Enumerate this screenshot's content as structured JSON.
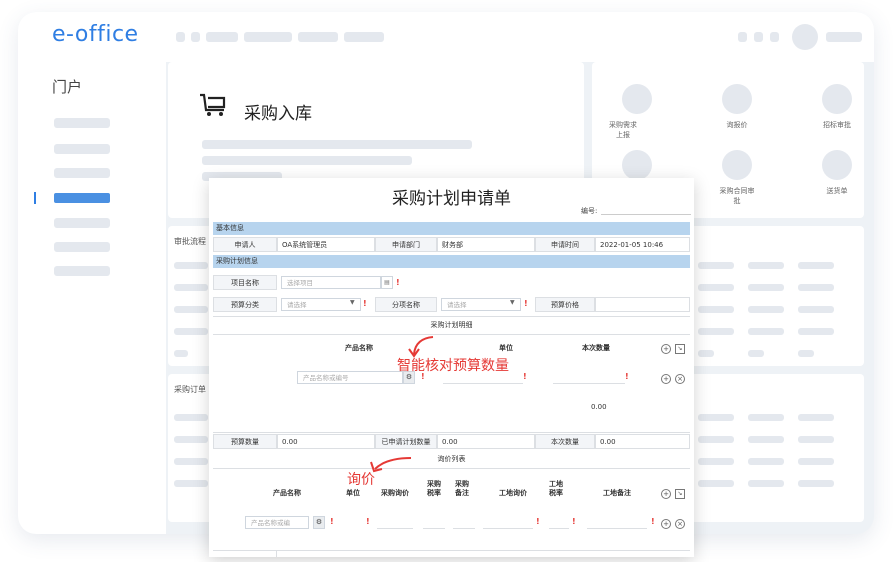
{
  "app": {
    "logo": "e-office"
  },
  "sidebar": {
    "title": "门户"
  },
  "module": {
    "title": "采购入库"
  },
  "quick_links": [
    {
      "label": "采购需求上报"
    },
    {
      "label": "询报价"
    },
    {
      "label": "招标审批"
    },
    {
      "label": "采购合同审批"
    },
    {
      "label": "送货单"
    }
  ],
  "sections": {
    "approval": "审批流程",
    "orders": "采购订单"
  },
  "form": {
    "title": "采购计划申请单",
    "number_label": "编号:",
    "basic_info": "基本信息",
    "applicant_label": "申请人",
    "applicant_value": "OA系统管理员",
    "dept_label": "申请部门",
    "dept_value": "财务部",
    "time_label": "申请时间",
    "time_value": "2022-01-05 10:46",
    "plan_info": "采购计划信息",
    "project_label": "项目名称",
    "project_placeholder": "选择项目",
    "budget_cat_label": "预算分类",
    "budget_cat_placeholder": "请选择",
    "sub_label": "分项名称",
    "sub_placeholder": "请选择",
    "budget_price_label": "预算价格",
    "plan_detail": "采购计划明细",
    "col_product": "产品名称",
    "col_unit": "单位",
    "col_qty": "本次数量",
    "product_placeholder": "产品名称或编号",
    "total": "0.00",
    "budget_qty_label": "预算数量",
    "budget_qty_value": "0.00",
    "planned_qty_label": "已申请计划数量",
    "planned_qty_value": "0.00",
    "this_qty_label": "本次数量",
    "this_qty_value": "0.00",
    "inquiry_list": "询价列表",
    "inq_col_product": "产品名称",
    "inq_col_unit": "单位",
    "inq_col_price": "采购询价",
    "inq_col_tax": "采购税率",
    "inq_col_note": "采购备注",
    "inq_col_site_price": "工地询价",
    "inq_col_site_tax": "工地税率",
    "inq_col_site_note": "工地备注",
    "inq_product_placeholder": "产品名称或编"
  },
  "annotations": {
    "budget": "智能核对预算数量",
    "inquiry": "询价"
  },
  "colors": {
    "accent": "#2f7ee3",
    "header_bar": "#b7d4ee",
    "annotation": "#e53935"
  }
}
